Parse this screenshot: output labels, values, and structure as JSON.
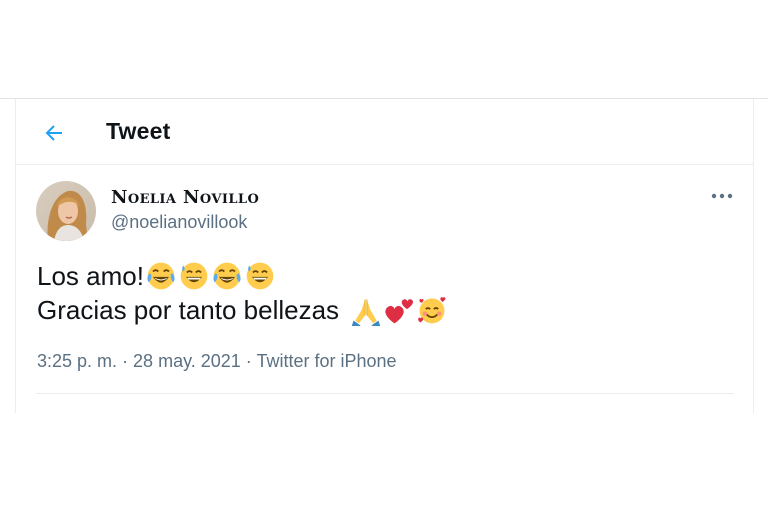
{
  "header": {
    "title": "Tweet"
  },
  "author": {
    "display_name": "Noelia Novillo",
    "handle": "@noelianovillook"
  },
  "tweet": {
    "line1_text": "Los amo!",
    "line1_emojis": [
      "face-with-tears-of-joy",
      "grinning-face-with-sweat",
      "face-with-tears-of-joy",
      "grinning-face-with-sweat"
    ],
    "line2_text": "Gracias por tanto bellezas ",
    "line2_emojis": [
      "folded-hands",
      "two-hearts",
      "smiling-face-with-hearts"
    ]
  },
  "meta": {
    "time": "3:25 p. m.",
    "separator": " · ",
    "date": "28 may. 2021",
    "source": "Twitter for iPhone"
  },
  "colors": {
    "accent": "#1da1f2",
    "text_primary": "#0f1419",
    "text_secondary": "#5b7083",
    "divider": "#ebeef0"
  },
  "icons": {
    "back": "arrow-left-icon",
    "more": "more-horizontal-icon"
  }
}
